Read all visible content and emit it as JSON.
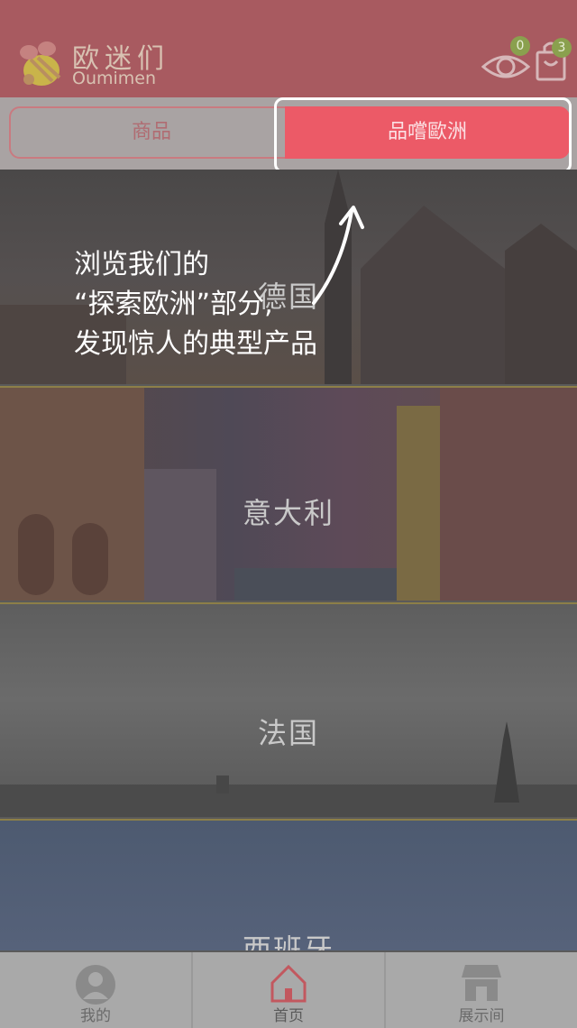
{
  "header": {
    "brand_cn": "欧迷们",
    "brand_en": "Oumimen",
    "eye_badge": "0",
    "cart_badge": "3"
  },
  "tabs": {
    "goods": "商品",
    "taste_europe": "品嚐歐洲"
  },
  "hint": {
    "line1": "浏览我们的",
    "line2": "“探索欧洲”部分,",
    "line3": "发现惊人的典型产品"
  },
  "countries": [
    "德国",
    "意大利",
    "法国",
    "西班牙"
  ],
  "bottom_nav": {
    "mine": "我的",
    "home": "首页",
    "showroom": "展示间"
  },
  "colors": {
    "header_bg": "#a85a60",
    "accent_red": "#ec5a67",
    "badge_green": "#8aa04e"
  }
}
